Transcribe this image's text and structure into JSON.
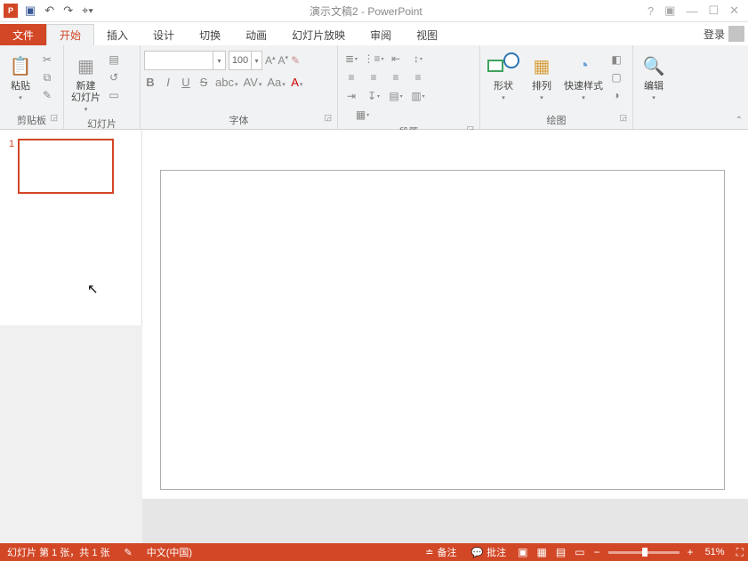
{
  "title": "演示文稿2 - PowerPoint",
  "login": "登录",
  "tabs": {
    "file": "文件",
    "home": "开始",
    "insert": "插入",
    "design": "设计",
    "transitions": "切换",
    "animations": "动画",
    "slideshow": "幻灯片放映",
    "review": "审阅",
    "view": "视图"
  },
  "groups": {
    "clipboard": "剪贴板",
    "slides": "幻灯片",
    "font": "字体",
    "paragraph": "段落",
    "drawing": "绘图",
    "editing": "编辑"
  },
  "clipboard": {
    "paste": "粘贴"
  },
  "slides": {
    "new": "新建\n幻灯片"
  },
  "font": {
    "size": "100",
    "aa": "Aa"
  },
  "drawing": {
    "shapes": "形状",
    "arrange": "排列",
    "quickstyles": "快速样式"
  },
  "thumb": {
    "num": "1"
  },
  "status": {
    "slide": "幻灯片 第 1 张，共 1 张",
    "lang": "中文(中国)",
    "notes": "备注",
    "comments": "批注",
    "zoom": "51%"
  }
}
